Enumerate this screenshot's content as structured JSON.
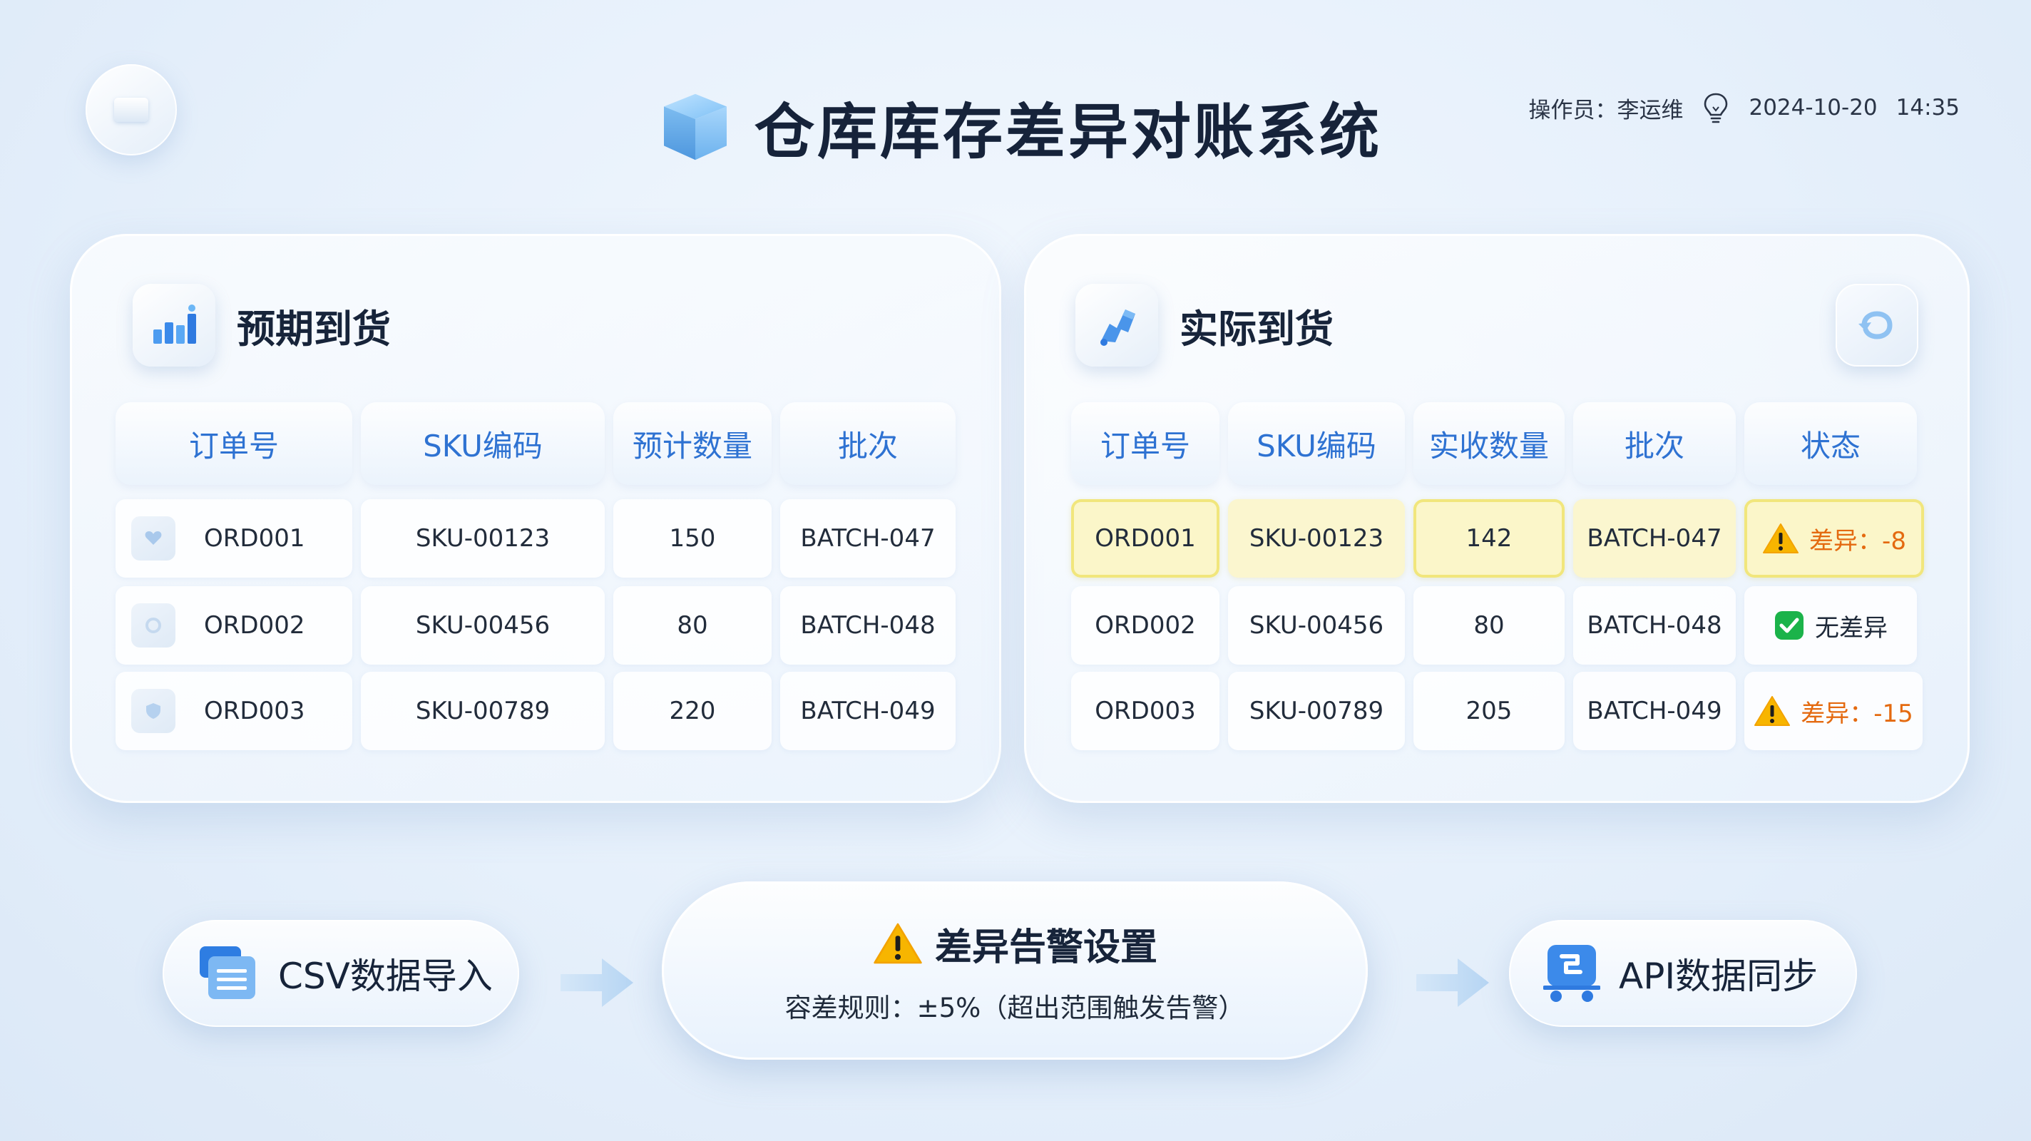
{
  "app": {
    "title": "仓库库存差异对账系统",
    "operator": "操作员：李运维",
    "date": "2024-10-20",
    "time": "14:35"
  },
  "expected": {
    "title": "预期到货",
    "headers": [
      "订单号",
      "SKU编码",
      "预计数量",
      "批次"
    ],
    "rows": [
      {
        "order": "ORD001",
        "sku": "SKU-00123",
        "qty": "150",
        "batch": "BATCH-047"
      },
      {
        "order": "ORD002",
        "sku": "SKU-00456",
        "qty": "80",
        "batch": "BATCH-048"
      },
      {
        "order": "ORD003",
        "sku": "SKU-00789",
        "qty": "220",
        "batch": "BATCH-049"
      }
    ]
  },
  "actual": {
    "title": "实际到货",
    "headers": [
      "订单号",
      "SKU编码",
      "实收数量",
      "批次",
      "状态"
    ],
    "rows": [
      {
        "order": "ORD001",
        "sku": "SKU-00123",
        "qty": "142",
        "batch": "BATCH-047",
        "status": "差异：-8",
        "status_type": "warning"
      },
      {
        "order": "ORD002",
        "sku": "SKU-00456",
        "qty": "80",
        "batch": "BATCH-048",
        "status": "无差异",
        "status_type": "ok"
      },
      {
        "order": "ORD003",
        "sku": "SKU-00789",
        "qty": "205",
        "batch": "BATCH-049",
        "status": "差异：-15",
        "status_type": "warning"
      }
    ]
  },
  "flow": {
    "csv_label": "CSV数据导入",
    "alert_title": "差异告警设置",
    "alert_rule": "容差规则：±5%（超出范围触发告警）",
    "api_label": "API数据同步"
  },
  "colors": {
    "accent": "#2e72d2",
    "warning": "#e46a10",
    "ok": "#1bb34a",
    "highlight": "#fbf6c9"
  },
  "icons": {
    "expected": "bar-chart-icon",
    "actual": "hand-truck-icon",
    "refresh": "refresh-icon",
    "csv": "file-stack-icon",
    "api": "cart-sync-icon"
  }
}
